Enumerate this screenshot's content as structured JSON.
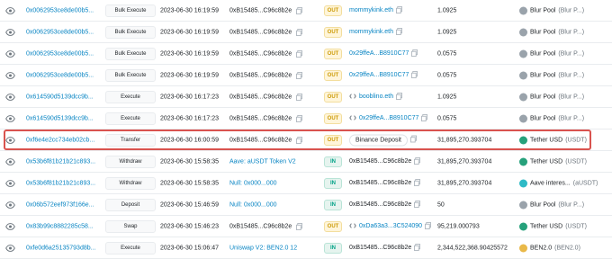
{
  "colors": {
    "link": "#0784c3",
    "highlight": "#d9534f",
    "out": "#cc9a06",
    "in": "#00a186"
  },
  "rows": [
    {
      "hash": "0x0062953ce8de00b5...",
      "method": "Bulk Execute",
      "age": "2023-06-30 16:19:59",
      "from": "0xB15485...C96c8b2e",
      "dir": "OUT",
      "to": "mommykink.eth",
      "to_style": "link",
      "to_icon": "copy",
      "value": "1.0925",
      "token": "Blur Pool",
      "token_sub": "(Blur P...)",
      "token_icon": "blur-pool-icon"
    },
    {
      "hash": "0x0062953ce8de00b5...",
      "method": "Bulk Execute",
      "age": "2023-06-30 16:19:59",
      "from": "0xB15485...C96c8b2e",
      "dir": "OUT",
      "to": "mommykink.eth",
      "to_style": "link",
      "to_icon": "copy",
      "value": "1.0925",
      "token": "Blur Pool",
      "token_sub": "(Blur P...)",
      "token_icon": "blur-pool-icon"
    },
    {
      "hash": "0x0062953ce8de00b5...",
      "method": "Bulk Execute",
      "age": "2023-06-30 16:19:59",
      "from": "0xB15485...C96c8b2e",
      "dir": "OUT",
      "to": "0x29ffeA...B8910C77",
      "to_style": "link",
      "to_icon": "copy",
      "value": "0.0575",
      "token": "Blur Pool",
      "token_sub": "(Blur P...)",
      "token_icon": "blur-pool-icon"
    },
    {
      "hash": "0x0062953ce8de00b5...",
      "method": "Bulk Execute",
      "age": "2023-06-30 16:19:59",
      "from": "0xB15485...C96c8b2e",
      "dir": "OUT",
      "to": "0x29ffeA...B8910C77",
      "to_style": "link",
      "to_icon": "copy",
      "value": "0.0575",
      "token": "Blur Pool",
      "token_sub": "(Blur P...)",
      "token_icon": "blur-pool-icon"
    },
    {
      "hash": "0x614590d5139dcc9b...",
      "method": "Execute",
      "age": "2023-06-30 16:17:23",
      "from": "0xB15485...C96c8b2e",
      "dir": "OUT",
      "to": "booblino.eth",
      "to_style": "link",
      "to_icon": "contract",
      "value": "1.0925",
      "token": "Blur Pool",
      "token_sub": "(Blur P...)",
      "token_icon": "blur-pool-icon"
    },
    {
      "hash": "0x614590d5139dcc9b...",
      "method": "Execute",
      "age": "2023-06-30 16:17:23",
      "from": "0xB15485...C96c8b2e",
      "dir": "OUT",
      "to": "0x29ffeA...B8910C77",
      "to_style": "link",
      "to_icon": "contract",
      "value": "0.0575",
      "token": "Blur Pool",
      "token_sub": "(Blur P...)",
      "token_icon": "blur-pool-icon"
    },
    {
      "hash": "0xf6e4e2cc734eb02cb...",
      "method": "Transfer",
      "age": "2023-06-30 16:00:59",
      "from": "0xB15485...C96c8b2e",
      "dir": "OUT",
      "to": "Binance Deposit",
      "to_style": "pill",
      "to_icon": "copy",
      "value": "31,895,270.393704",
      "token": "Tether USD",
      "token_sub": "(USDT)",
      "token_icon": "tether-icon",
      "highlight": true
    },
    {
      "hash": "0x53b6f81b21b21c893...",
      "method": "Withdraw",
      "age": "2023-06-30 15:58:35",
      "from": "Aave: aUSDT Token V2",
      "dir": "IN",
      "to": "0xB15485...C96c8b2e",
      "to_style": "plain",
      "to_icon": "copy",
      "value": "31,895,270.393704",
      "token": "Tether USD",
      "token_sub": "(USDT)",
      "token_icon": "tether-icon",
      "from_link": true
    },
    {
      "hash": "0x53b6f81b21b21c893...",
      "method": "Withdraw",
      "age": "2023-06-30 15:58:35",
      "from": "Null: 0x000...000",
      "dir": "IN",
      "to": "0xB15485...C96c8b2e",
      "to_style": "plain",
      "to_icon": "copy",
      "value": "31,895,270.393704",
      "token": "Aave interes...",
      "token_sub": "(aUSDT)",
      "token_icon": "aave-icon",
      "from_link": true
    },
    {
      "hash": "0x06b572eef973f166e...",
      "method": "Deposit",
      "age": "2023-06-30 15:46:59",
      "from": "Null: 0x000...000",
      "dir": "IN",
      "to": "0xB15485...C96c8b2e",
      "to_style": "plain",
      "to_icon": "copy",
      "value": "50",
      "token": "Blur Pool",
      "token_sub": "(Blur P...)",
      "token_icon": "blur-pool-icon",
      "from_link": true
    },
    {
      "hash": "0x83b99c8882285c58...",
      "method": "Swap",
      "age": "2023-06-30 15:46:23",
      "from": "0xB15485...C96c8b2e",
      "dir": "OUT",
      "to": "0xDa63a3...3C524090",
      "to_style": "link",
      "to_icon": "contract",
      "value": "95,219.000793",
      "token": "Tether USD",
      "token_sub": "(USDT)",
      "token_icon": "tether-icon"
    },
    {
      "hash": "0xfe0d6a25135793d8b...",
      "method": "Execute",
      "age": "2023-06-30 15:06:47",
      "from": "Uniswap V2: BEN2.0 12",
      "dir": "IN",
      "to": "0xB15485...C96c8b2e",
      "to_style": "plain",
      "to_icon": "copy",
      "value": "2,344,522,368.90425572",
      "token": "BEN2.0",
      "token_sub": "(BEN2.0)",
      "token_icon": "ben-icon",
      "from_link": true
    }
  ]
}
